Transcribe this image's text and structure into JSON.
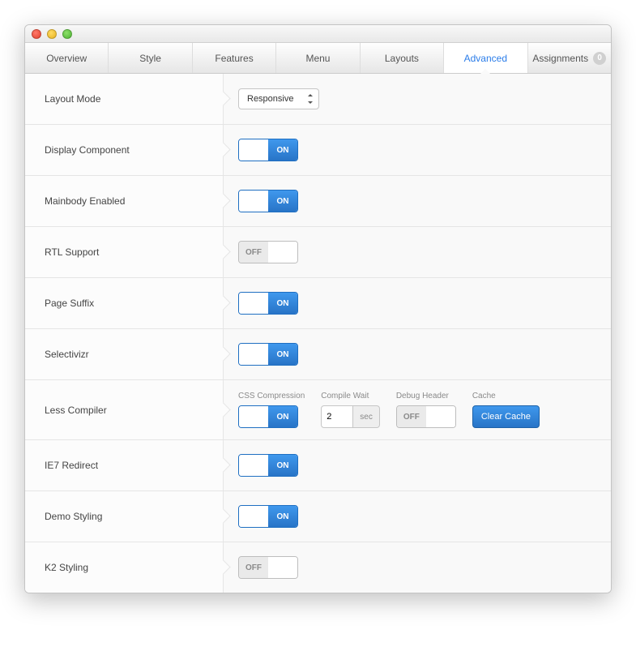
{
  "tabs": {
    "overview": "Overview",
    "style": "Style",
    "features": "Features",
    "menu": "Menu",
    "layouts": "Layouts",
    "advanced": "Advanced",
    "assignments": "Assignments",
    "assignments_count": "0"
  },
  "rows": {
    "layout_mode": {
      "label": "Layout Mode",
      "value": "Responsive"
    },
    "display_component": {
      "label": "Display Component",
      "state": "ON"
    },
    "mainbody_enabled": {
      "label": "Mainbody Enabled",
      "state": "ON"
    },
    "rtl_support": {
      "label": "RTL Support",
      "state": "OFF"
    },
    "page_suffix": {
      "label": "Page Suffix",
      "state": "ON"
    },
    "selectivizr": {
      "label": "Selectivizr",
      "state": "ON"
    },
    "less_compiler": {
      "label": "Less Compiler",
      "css_compression": {
        "label": "CSS Compression",
        "state": "ON"
      },
      "compile_wait": {
        "label": "Compile Wait",
        "value": "2",
        "unit": "sec"
      },
      "debug_header": {
        "label": "Debug Header",
        "state": "OFF"
      },
      "cache": {
        "label": "Cache",
        "button": "Clear Cache"
      }
    },
    "ie7_redirect": {
      "label": "IE7 Redirect",
      "state": "ON"
    },
    "demo_styling": {
      "label": "Demo Styling",
      "state": "ON"
    },
    "k2_styling": {
      "label": "K2 Styling",
      "state": "OFF"
    }
  }
}
